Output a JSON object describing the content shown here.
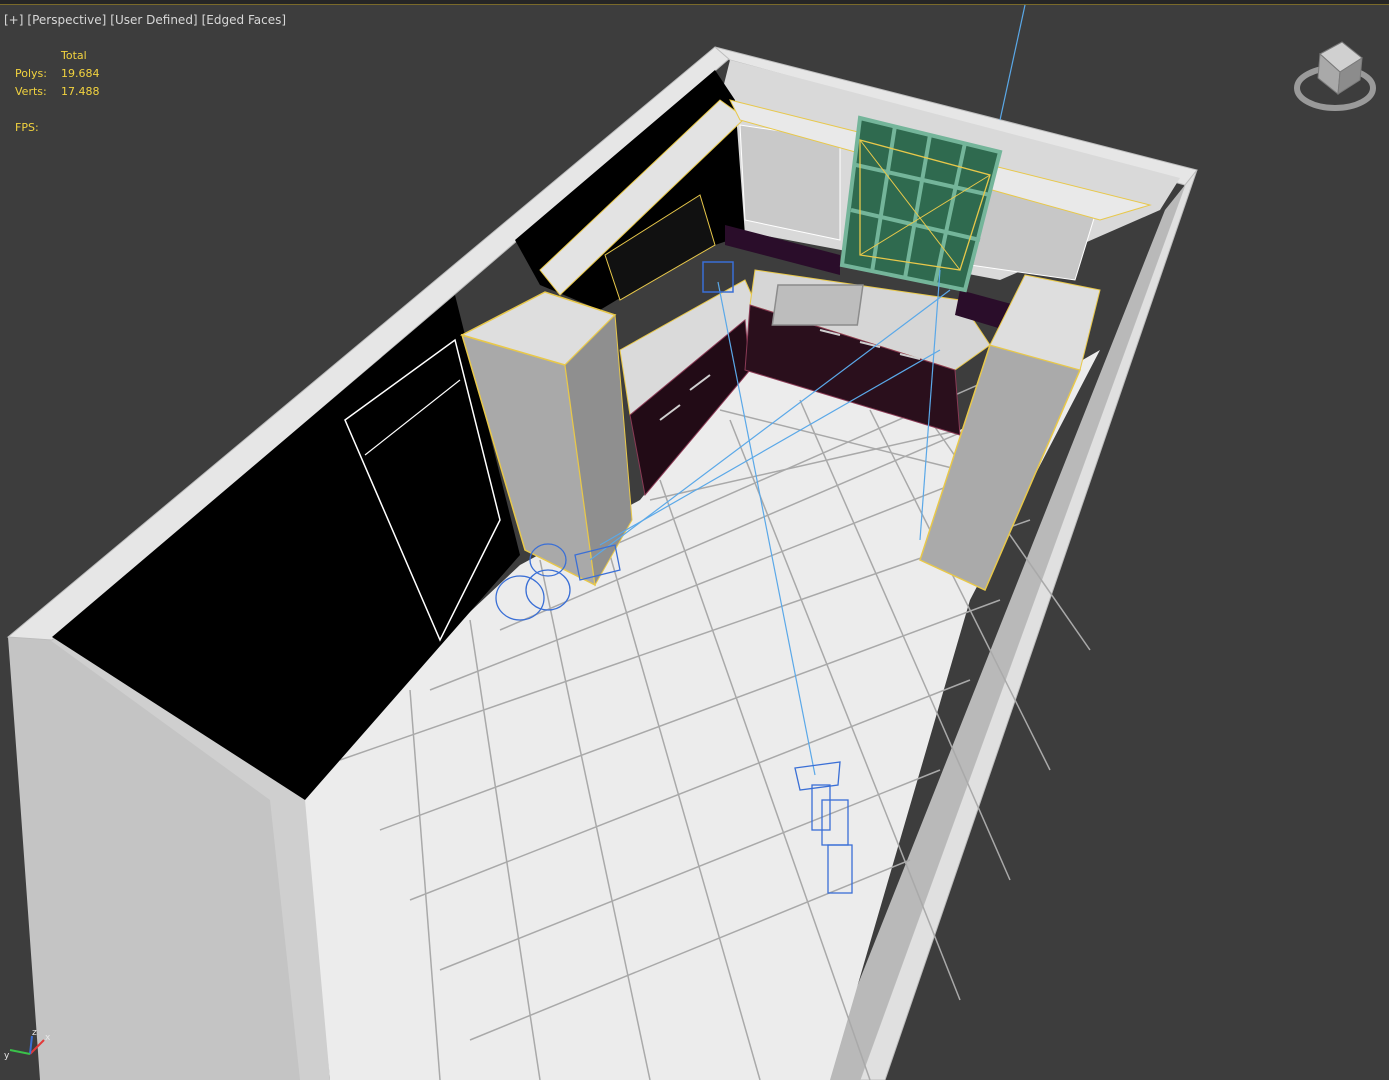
{
  "viewport": {
    "label_parts": [
      "[+]",
      "[Perspective]",
      "[User Defined]",
      "[Edged Faces]"
    ]
  },
  "stats": {
    "column_header": "Total",
    "polys_label": "Polys:",
    "polys_value": "19.684",
    "verts_label": "Verts:",
    "verts_value": "17.488",
    "fps_label": "FPS:"
  },
  "viewcube": {
    "icon": "viewcube-icon"
  },
  "axis_tripod": {
    "icon": "axis-tripod-icon",
    "x_label": "x",
    "y_label": "y",
    "z_label": "z"
  },
  "colors": {
    "viewport_bg": "#3d3d3d",
    "stats_text": "#f2d33f",
    "selection_edge": "#e8c84a",
    "helper_wire": "#3a6fd6",
    "target_line": "#5aa8e8",
    "wall_top": "#e4e4e4",
    "floor_tile": "#e9e9e9",
    "cabinet_dark": "#2a0f1c",
    "window_frame": "#74b59a"
  }
}
